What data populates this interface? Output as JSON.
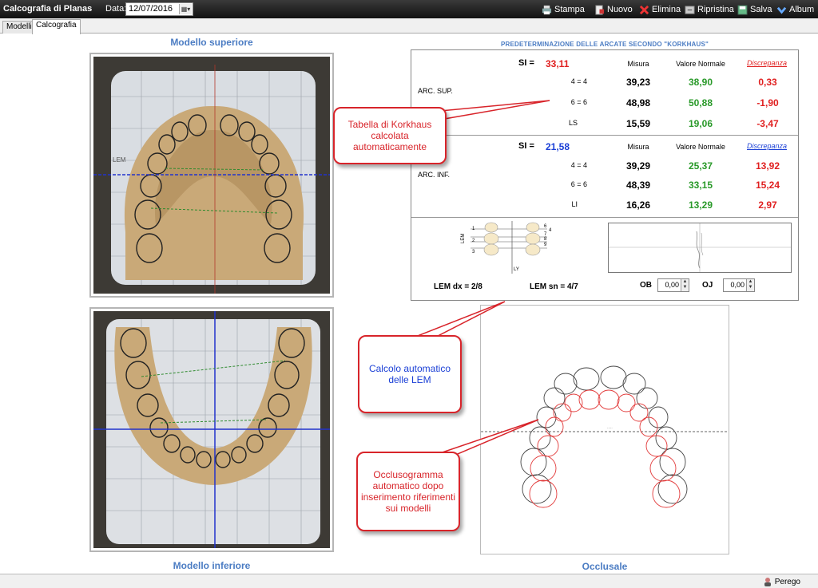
{
  "app": {
    "title": "Calcografia di Planas"
  },
  "toolbar": {
    "date_label": "Data:",
    "date_value": "12/07/2016",
    "buttons": [
      {
        "label": "Stampa",
        "icon": "printer-icon"
      },
      {
        "label": "Nuovo",
        "icon": "new-document-icon"
      },
      {
        "label": "Elimina",
        "icon": "delete-icon"
      },
      {
        "label": "Ripristina",
        "icon": "restore-icon"
      },
      {
        "label": "Salva",
        "icon": "save-icon"
      },
      {
        "label": "Album",
        "icon": "album-icon"
      }
    ]
  },
  "tabs": [
    "Modelli",
    "Calcografia"
  ],
  "labels": {
    "upper_model": "Modello superiore",
    "lower_model": "Modello inferiore",
    "occlusal": "Occlusale",
    "lem_left_label": "LEM",
    "photo_lem_label": "LEM"
  },
  "korkhaus": {
    "heading": "PREDETERMINAZIONE DELLE ARCATE SECONDO \"KORKHAUS\"",
    "upper": {
      "arch_label": "ARC. SUP.",
      "si_label": "SI =",
      "si_value": "33,11",
      "col_measure": "Misura",
      "col_normal": "Valore Normale",
      "col_discrepancy": "Discrepanza",
      "rows": [
        {
          "label": "4 = 4",
          "measure": "39,23",
          "normal": "38,90",
          "discrepancy": "0,33"
        },
        {
          "label": "6 = 6",
          "measure": "48,98",
          "normal": "50,88",
          "discrepancy": "-1,90"
        },
        {
          "label": "LS",
          "measure": "15,59",
          "normal": "19,06",
          "discrepancy": "-3,47"
        }
      ]
    },
    "lower": {
      "arch_label": "ARC. INF.",
      "si_label": "SI =",
      "si_value": "21,58",
      "col_measure": "Misura",
      "col_normal": "Valore Normale",
      "col_discrepancy": "Discrepanza",
      "rows": [
        {
          "label": "4 = 4",
          "measure": "39,29",
          "normal": "25,37",
          "discrepancy": "13,92"
        },
        {
          "label": "6 = 6",
          "measure": "48,39",
          "normal": "33,15",
          "discrepancy": "15,24"
        },
        {
          "label": "LI",
          "measure": "16,26",
          "normal": "13,29",
          "discrepancy": "2,97"
        }
      ]
    },
    "lem": {
      "dx": "LEM dx = 2/8",
      "sn": "LEM sn = 4/7",
      "ob_label": "OB",
      "ob_value": "0,00",
      "oj_label": "OJ",
      "oj_value": "0,00",
      "diagram_left_numbers": [
        "1",
        "2",
        "3"
      ],
      "diagram_right_numbers": [
        "6",
        "4",
        "7",
        "8",
        "9"
      ],
      "diagram_ly": "LY"
    }
  },
  "callouts": {
    "korkhaus": "Tabella di Korkhaus calcolata automaticamente",
    "lem": "Calcolo automatico delle LEM",
    "occlusogram": "Occlusogramma automatico dopo inserimento riferimenti sui modelli"
  },
  "status": {
    "user": "Perego"
  },
  "colors": {
    "accent_blue": "#4b7cc3",
    "green": "#2a9a2a",
    "red": "#e02020",
    "blue": "#1a3fd6",
    "callout_border": "#d8242a"
  }
}
